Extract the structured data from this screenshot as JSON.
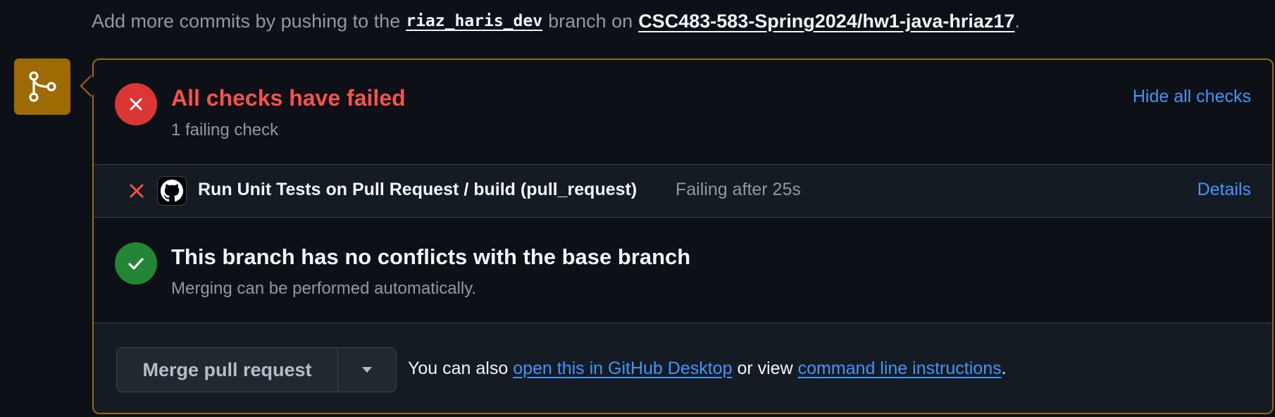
{
  "header": {
    "prefix": "Add more commits by pushing to the",
    "branch": "riaz_haris_dev",
    "middle": "branch on",
    "repo": "CSC483-583-Spring2024/hw1-java-hriaz17",
    "suffix": "."
  },
  "icons": {
    "merge": "git-merge-icon",
    "fail": "x-circle-icon",
    "success": "check-circle-icon",
    "row_fail": "x-icon",
    "app": "github-icon",
    "caret": "triangle-down-icon"
  },
  "colors": {
    "accent_border": "#9e6a03",
    "fail": "#da3633",
    "fail_text": "#f85149",
    "success": "#238636",
    "link": "#4493f8",
    "background": "#0d1117"
  },
  "checks": {
    "title": "All checks have failed",
    "subtitle": "1 failing check",
    "toggle_label": "Hide all checks",
    "items": [
      {
        "name": "Run Unit Tests on Pull Request / build (pull_request)",
        "status": "Failing after 25s",
        "details_label": "Details"
      }
    ]
  },
  "conflicts": {
    "title": "This branch has no conflicts with the base branch",
    "subtitle": "Merging can be performed automatically."
  },
  "merge": {
    "button_label": "Merge pull request",
    "also_prefix": "You can also",
    "desktop_link": "open this in GitHub Desktop",
    "or_view": "or view",
    "cli_link": "command line instructions",
    "suffix": "."
  }
}
